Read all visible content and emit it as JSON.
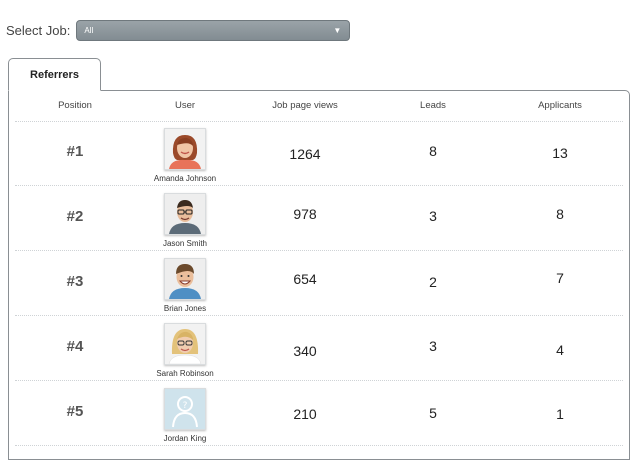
{
  "filter": {
    "label": "Select Job:",
    "selected": "All"
  },
  "tab": {
    "label": "Referrers"
  },
  "table": {
    "columns": [
      "Position",
      "User",
      "Job page views",
      "Leads",
      "Applicants"
    ],
    "rows": [
      {
        "position": "#1",
        "user": "Amanda Johnson",
        "views": "1264",
        "leads": "8",
        "applicants": "13",
        "avatar": "woman-red-hair-icon"
      },
      {
        "position": "#2",
        "user": "Jason Smith",
        "views": "978",
        "leads": "3",
        "applicants": "8",
        "avatar": "man-glasses-icon"
      },
      {
        "position": "#3",
        "user": "Brian Jones",
        "views": "654",
        "leads": "2",
        "applicants": "7",
        "avatar": "man-smiling-icon"
      },
      {
        "position": "#4",
        "user": "Sarah Robinson",
        "views": "340",
        "leads": "3",
        "applicants": "4",
        "avatar": "woman-blonde-glasses-icon"
      },
      {
        "position": "#5",
        "user": "Jordan King",
        "views": "210",
        "leads": "5",
        "applicants": "1",
        "avatar": "default-user-icon"
      }
    ]
  }
}
